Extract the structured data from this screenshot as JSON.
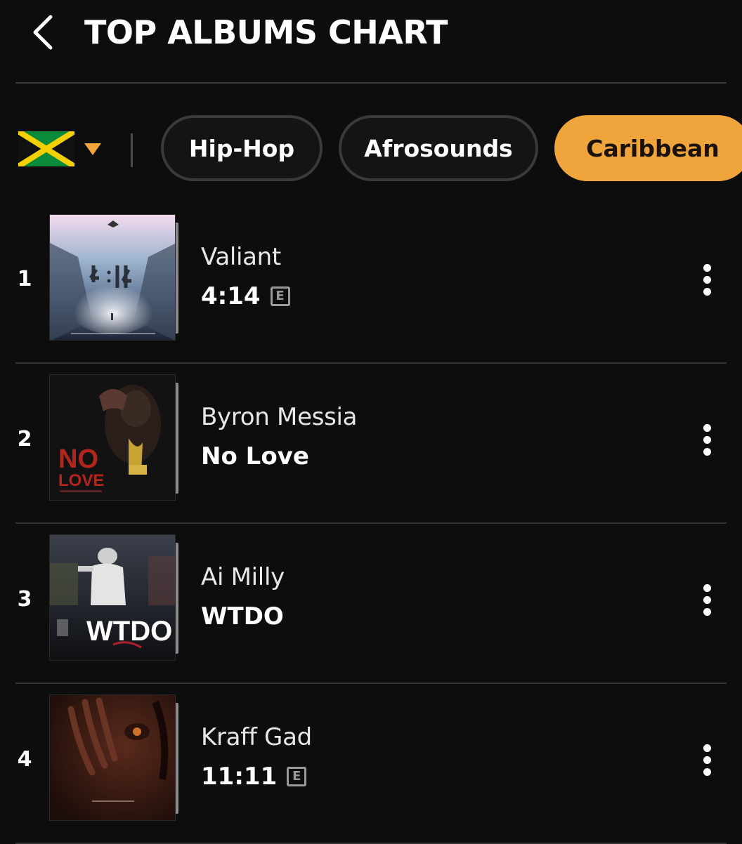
{
  "header": {
    "title": "TOP ALBUMS CHART",
    "back_icon": "chevron-left-icon"
  },
  "filters": {
    "country": {
      "flag_icon": "jamaica-flag-icon",
      "dropdown_icon": "caret-down-icon"
    },
    "genres": [
      {
        "label": "Hip-Hop",
        "selected": false
      },
      {
        "label": "Afrosounds",
        "selected": false
      },
      {
        "label": "Caribbean",
        "selected": true
      }
    ],
    "accent_color": "#f0a53c"
  },
  "chart": {
    "items": [
      {
        "rank": "1",
        "artist": "Valiant",
        "title": "4:14",
        "explicit": true,
        "explicit_label": "E"
      },
      {
        "rank": "2",
        "artist": "Byron Messia",
        "title": "No Love",
        "explicit": false
      },
      {
        "rank": "3",
        "artist": "Ai Milly",
        "title": "WTDO",
        "explicit": false
      },
      {
        "rank": "4",
        "artist": "Kraff Gad",
        "title": "11:11",
        "explicit": true,
        "explicit_label": "E"
      }
    ],
    "more_icon": "more-vertical-icon"
  }
}
